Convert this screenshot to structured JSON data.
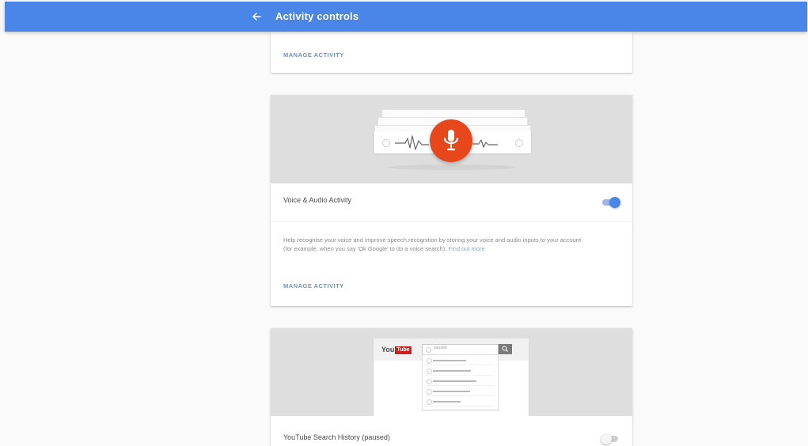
{
  "header": {
    "title": "Activity controls",
    "back_label": "←"
  },
  "cards": {
    "top": {
      "manage_label": "MANAGE ACTIVITY"
    },
    "voice": {
      "title": "Voice & Audio Activity",
      "toggle": "on",
      "description": "Help recognise your voice and improve speech recognition by storing your voice and audio inputs to your account (for example, when you say 'Ok Google' to do a voice search).",
      "find_out_more": "Find out more",
      "manage_label": "MANAGE ACTIVITY"
    },
    "youtube": {
      "title": "YouTube Search History (paused)",
      "toggle": "off",
      "logo_you": "You",
      "logo_tube": "Tube",
      "search_value": "paused"
    }
  },
  "colors": {
    "primary": "#4a86e8",
    "mic": "#e8471b",
    "youtube_red": "#cc1f1f"
  },
  "icons": {
    "back": "arrow-left-icon",
    "mic": "microphone-icon",
    "youtube_search": "search-icon",
    "history": "clock-icon"
  }
}
